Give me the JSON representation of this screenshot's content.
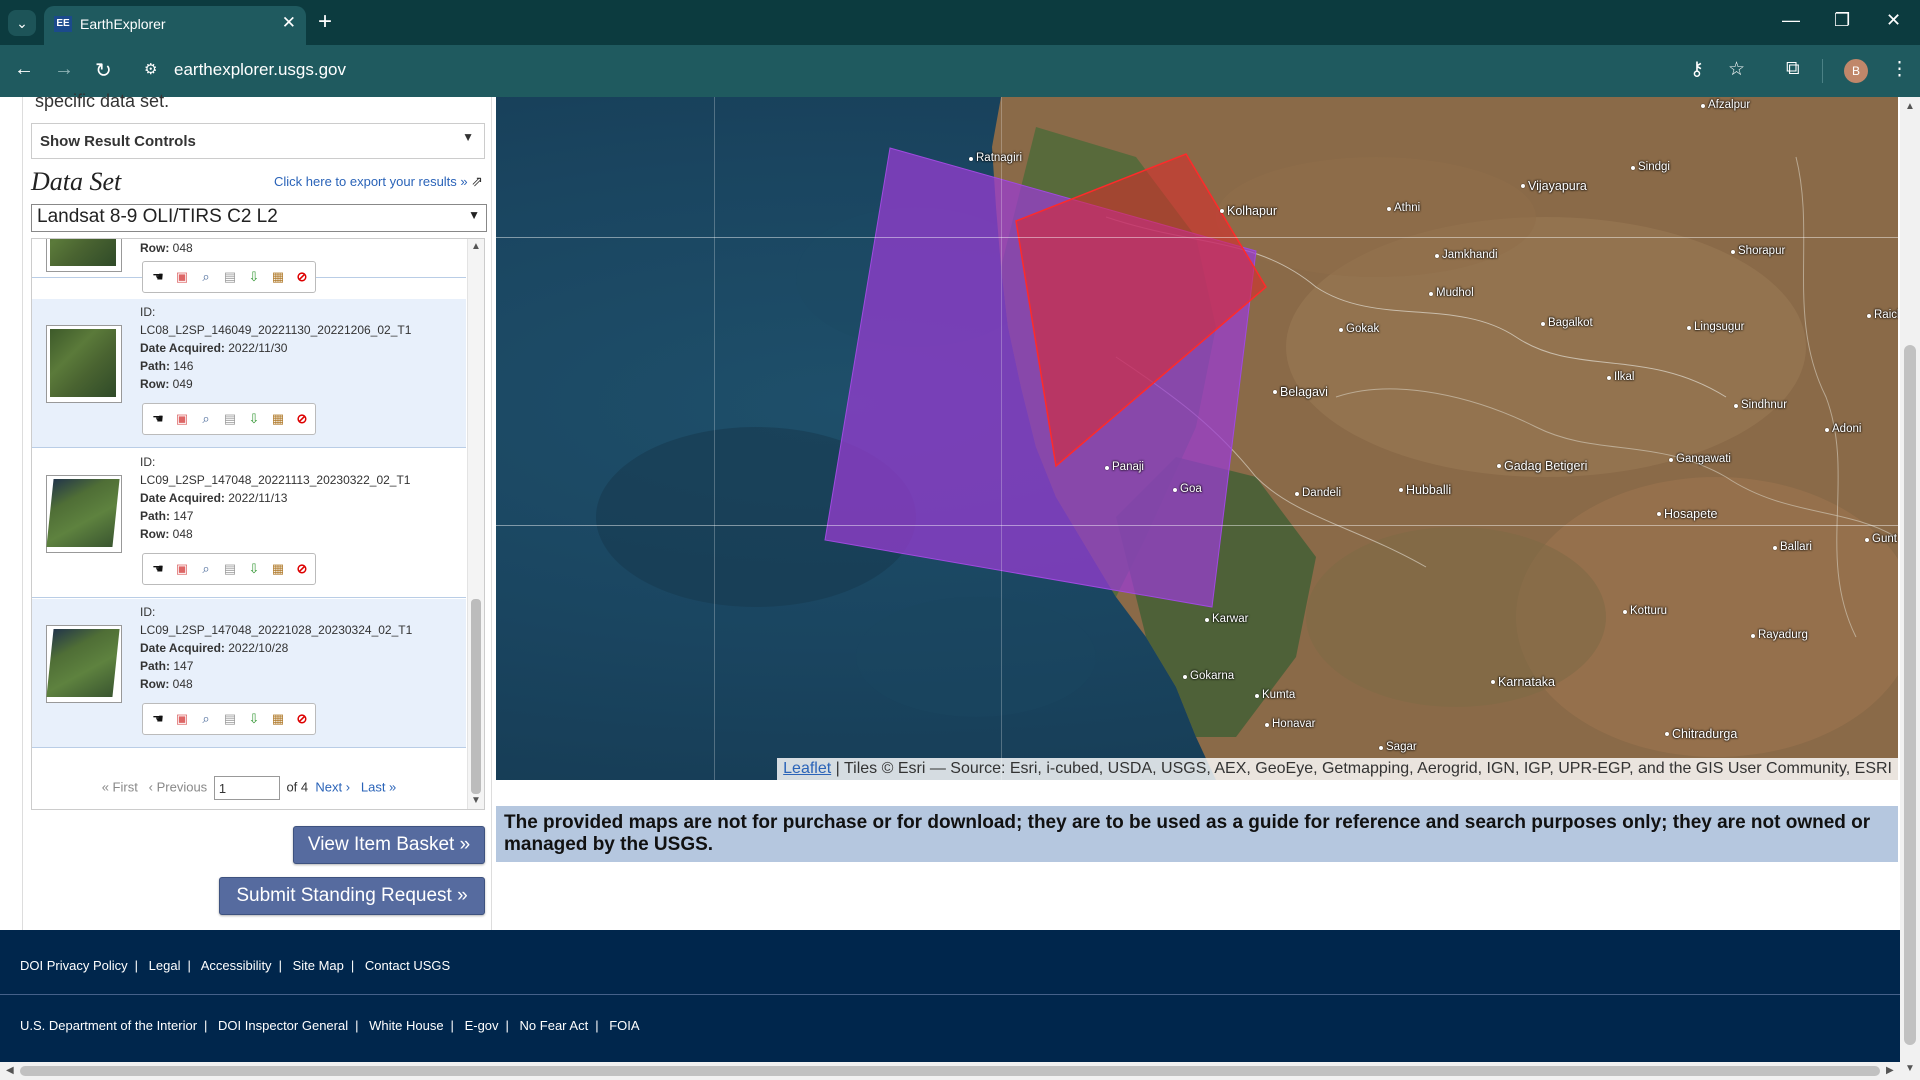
{
  "browser": {
    "tab_title": "EarthExplorer",
    "tab_favicon": "EE",
    "url": "earthexplorer.usgs.gov",
    "profile_initial": "B"
  },
  "left_panel": {
    "cut_text": "specific data set.",
    "result_controls": "Show Result Controls",
    "dataset_title": "Data Set",
    "export_link": "Click here to export your results »",
    "dataset_value": "Landsat 8-9 OLI/TIRS C2 L2",
    "partial_entry": {
      "row_label": "Row:",
      "row": "048"
    },
    "entries": [
      {
        "id_label": "ID:",
        "id": "LC08_L2SP_146049_20221130_20221206_02_T1",
        "date_label": "Date Acquired:",
        "date": "2022/11/30",
        "path_label": "Path:",
        "path": "146",
        "row_label": "Row:",
        "row": "049"
      },
      {
        "id_label": "ID:",
        "id": "LC09_L2SP_147048_20221113_20230322_02_T1",
        "date_label": "Date Acquired:",
        "date": "2022/11/13",
        "path_label": "Path:",
        "path": "147",
        "row_label": "Row:",
        "row": "048"
      },
      {
        "id_label": "ID:",
        "id": "LC09_L2SP_147048_20221028_20230324_02_T1",
        "date_label": "Date Acquired:",
        "date": "2022/10/28",
        "path_label": "Path:",
        "path": "147",
        "row_label": "Row:",
        "row": "048"
      }
    ],
    "pager": {
      "first": "« First",
      "previous": "‹ Previous",
      "page_value": "1",
      "of_text": "of 4",
      "next": "Next ›",
      "last": "Last »"
    },
    "view_basket": "View Item Basket »",
    "standing_request": "Submit Standing Request »"
  },
  "map": {
    "places": [
      "Afzalpur",
      "Ratnagiri",
      "Kolhapur",
      "Vijayapura",
      "Sindgi",
      "Athni",
      "Jamkhandi",
      "Shorapur",
      "Mudhol",
      "Gokak",
      "Bagalkot",
      "Lingsugur",
      "Raich",
      "Ilkal",
      "Belagavi",
      "Sindhnur",
      "Adoni",
      "Gadag Betigeri",
      "Gangawati",
      "Hubballi",
      "Panaji",
      "Goa",
      "Dandeli",
      "Hosapete",
      "Ballari",
      "Gunt",
      "Karwar",
      "Kotturu",
      "Rayadurg",
      "Gokarna",
      "Kumta",
      "Karnataka",
      "Honavar",
      "Sagar",
      "Chitradurga"
    ],
    "attribution_link": "Leaflet",
    "attribution_text": "Tiles © Esri — Source: Esri, i-cubed, USDA, USGS, AEX, GeoEye, Getmapping, Aerogrid, IGN, IGP, UPR-EGP, and the GIS User Community, ESRI",
    "footprint_colors": {
      "purple": "#9b3bd6",
      "red": "#e0282a"
    }
  },
  "disclaimer": "The provided maps are not for purchase or for download; they are to be used as a guide for reference and search purposes only; they are not owned or managed by the USGS.",
  "footer": {
    "row1": [
      "DOI Privacy Policy",
      "Legal",
      "Accessibility",
      "Site Map",
      "Contact USGS"
    ],
    "row2": [
      "U.S. Department of the Interior",
      "DOI Inspector General",
      "White House",
      "E-gov",
      "No Fear Act",
      "FOIA"
    ]
  }
}
